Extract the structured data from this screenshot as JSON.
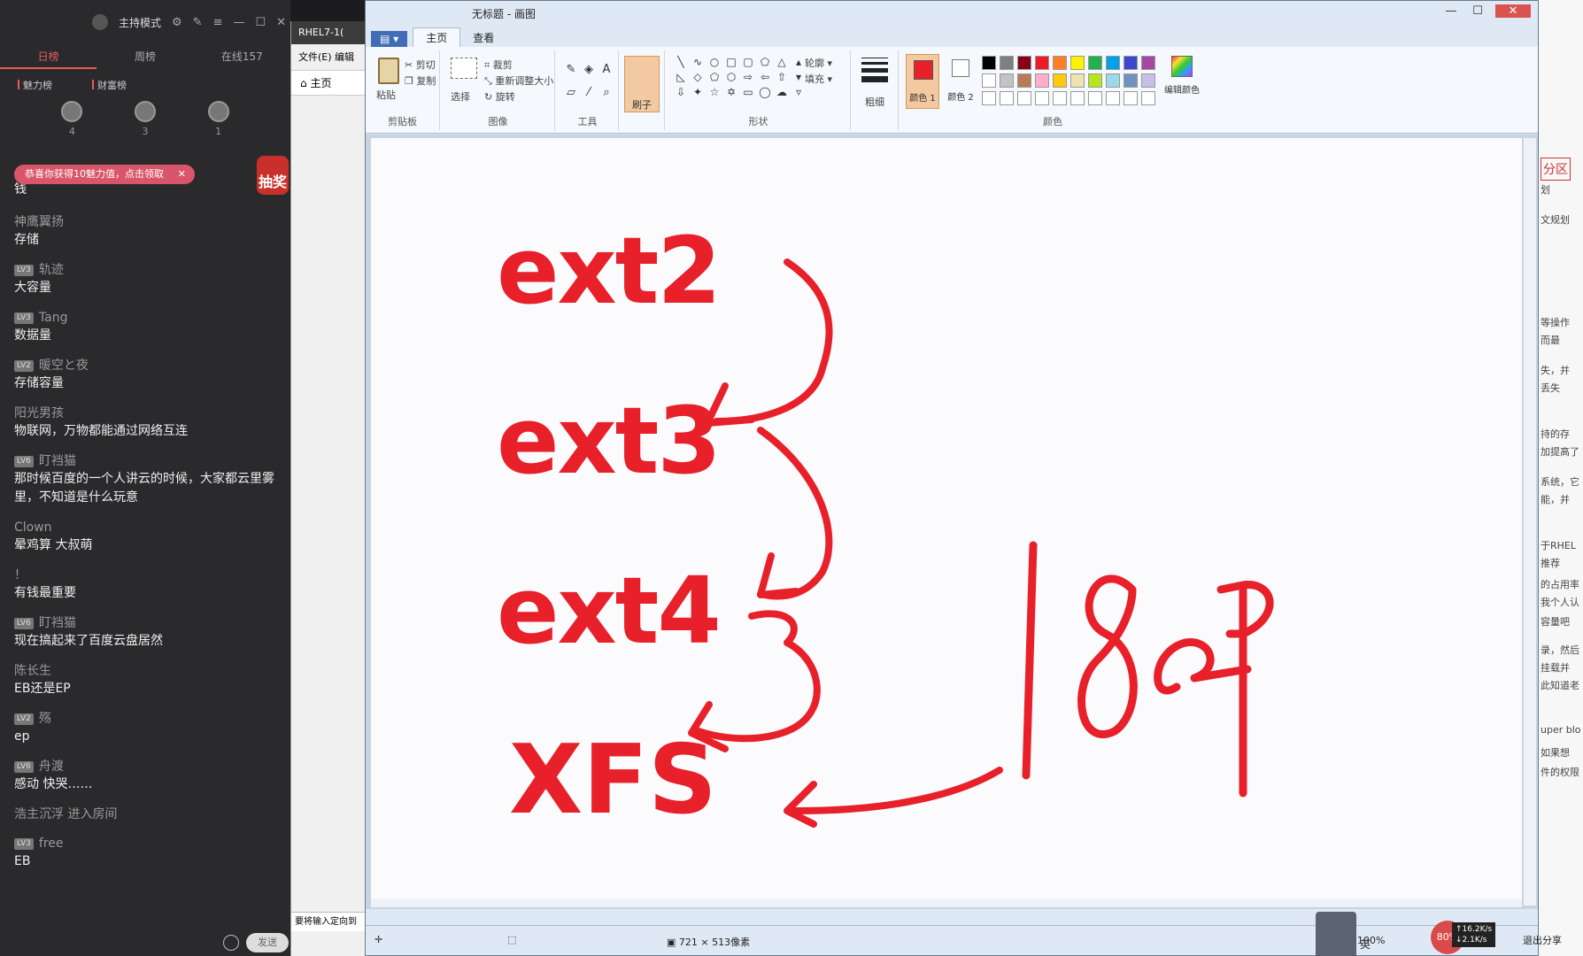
{
  "chat": {
    "header": {
      "mode": "主持模式"
    },
    "tabs": [
      "日榜",
      "周榜",
      "在线157"
    ],
    "ranks": [
      "魅力榜",
      "财富榜"
    ],
    "top_users": [
      "4",
      "3",
      "1"
    ],
    "notice": "恭喜你获得10魅力值，点击领取",
    "lottery": "抽奖",
    "messages": [
      {
        "user": "",
        "level": "",
        "text": "钱"
      },
      {
        "user": "神鹰翼扬",
        "level": "",
        "text": "存储"
      },
      {
        "user": "轨迹",
        "level": "LV3",
        "text": "大容量"
      },
      {
        "user": "Tang",
        "level": "LV3",
        "text": "数据量"
      },
      {
        "user": "暖空と夜",
        "level": "LV2",
        "text": "存储容量"
      },
      {
        "user": "阳光男孩",
        "level": "",
        "text": "物联网，万物都能通过网络互连"
      },
      {
        "user": "盯裆猫",
        "level": "LV6",
        "text": "那时候百度的一个人讲云的时候，大家都云里雾里，不知道是什么玩意"
      },
      {
        "user": "Clown",
        "level": "",
        "text": "晕鸡算 大叔萌"
      },
      {
        "user": "！",
        "level": "",
        "text": "有钱最重要"
      },
      {
        "user": "盯裆猫",
        "level": "LV6",
        "text": "现在搞起来了百度云盘居然"
      },
      {
        "user": "陈长生",
        "level": "",
        "text": "EB还是EP"
      },
      {
        "user": "殇",
        "level": "LV2",
        "text": "ep"
      },
      {
        "user": "舟渡",
        "level": "LV6",
        "text": "感动 快哭……"
      },
      {
        "user": "",
        "level": "",
        "text": "浩主沉浮 进入房间"
      },
      {
        "user": "free",
        "level": "LV3",
        "text": "EB"
      }
    ],
    "send_label": "发送"
  },
  "browser": {
    "tab_title": "RHEL7-1(",
    "menu": "文件(E)  编辑",
    "home_label": "主页",
    "footer_hint": "要将输入定向到"
  },
  "paint": {
    "window_title": "无标题 - 画图",
    "ribbon_tabs": [
      "主页",
      "查看"
    ],
    "groups": {
      "clipboard": {
        "label": "剪贴板",
        "paste": "粘贴",
        "cut": "剪切",
        "copy": "复制"
      },
      "image": {
        "label": "图像",
        "select": "选择",
        "crop": "裁剪",
        "resize": "重新调整大小",
        "rotate": "旋转"
      },
      "tools": {
        "label": "工具"
      },
      "brush": {
        "label": "刷子"
      },
      "shapes": {
        "label": "形状",
        "outline": "轮廓",
        "fill": "填充"
      },
      "size": {
        "label": "粗细"
      },
      "colors": {
        "label": "颜色",
        "color1": "颜色 1",
        "color2": "颜色 2",
        "edit": "编辑颜色"
      }
    },
    "palette": [
      "#000000",
      "#7f7f7f",
      "#880015",
      "#ed1c24",
      "#ff7f27",
      "#fff200",
      "#22b14c",
      "#00a2e8",
      "#3f48cc",
      "#a349a4",
      "#ffffff",
      "#c3c3c3",
      "#b97a57",
      "#ffaec9",
      "#ffc90e",
      "#efe4b0",
      "#b5e61d",
      "#99d9ea",
      "#7092be",
      "#c8bfe7",
      "#ffffff",
      "#ffffff",
      "#ffffff",
      "#ffffff",
      "#ffffff",
      "#ffffff",
      "#ffffff",
      "#ffffff",
      "#ffffff",
      "#ffffff"
    ],
    "canvas_text": [
      "ext2",
      "ext3",
      "ext4",
      "XFS"
    ],
    "handwritten": "18EP",
    "status": {
      "dimensions": "721 × 513像素",
      "zoom": "100%"
    },
    "accent_color": "#e8202a"
  },
  "doc_fragments": [
    "分区",
    "划",
    "文规划",
    "等操作",
    "而最",
    "失，并",
    "丢失",
    "持的存",
    "加提高了",
    "系统，它",
    "能，并",
    "于RHEL",
    "推荐",
    "的占用率",
    "我个人认",
    "容量吧",
    "录，然后",
    "挂载并",
    "此知道老",
    "uper blo",
    "如果想",
    "件的权限"
  ],
  "system": {
    "net_up": "16.2K/s",
    "net_down": "2.1K/s",
    "share": "退出分享",
    "cpu": "80%",
    "ime": "英"
  }
}
